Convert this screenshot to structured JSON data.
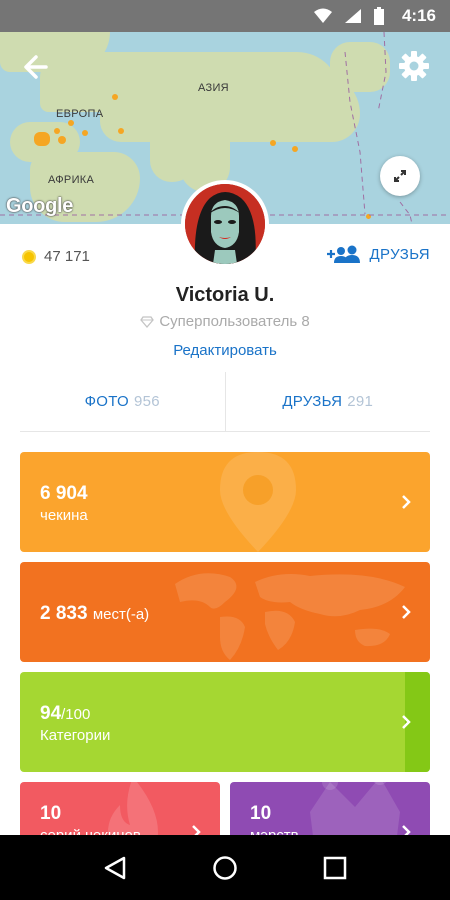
{
  "status_bar": {
    "time": "4:16"
  },
  "map": {
    "labels": {
      "asia": "АЗИЯ",
      "europe": "ЕВРОПА",
      "africa": "АФРИКА"
    },
    "google": "Google"
  },
  "profile": {
    "coins": "47 171",
    "friends_link": "ДРУЗЬЯ",
    "name": "Victoria U.",
    "rank": "Суперпользователь 8",
    "edit": "Редактировать"
  },
  "tabs": [
    {
      "label": "ФОТО",
      "count": "956"
    },
    {
      "label": "ДРУЗЬЯ",
      "count": "291"
    }
  ],
  "cards": {
    "checkins": {
      "value": "6 904",
      "caption": "чекина"
    },
    "places": {
      "value": "2 833",
      "unit": "мест(-а)"
    },
    "categories": {
      "value": "94",
      "total": "/100",
      "caption": "Категории"
    },
    "streaks": {
      "value": "10",
      "caption": "серий чекинов"
    },
    "mayors": {
      "value": "10",
      "caption": "мэрств"
    }
  },
  "colors": {
    "checkins": "#fba42d",
    "places": "#f27220",
    "categories": "#a5d732",
    "streaks": "#f25a61",
    "mayors": "#8f4bb3",
    "link": "#1a73c8"
  }
}
